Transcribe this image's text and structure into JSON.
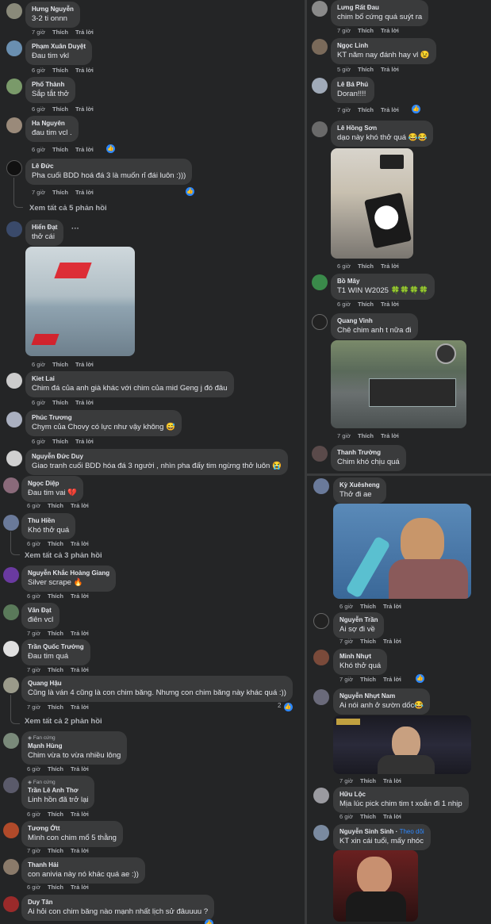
{
  "meta_labels": {
    "like": "Thích",
    "reply": "Trả lời"
  },
  "left_panel": {
    "comments": [
      {
        "name": "Hưng Nguyễn",
        "text": "3-2 ti onnn",
        "time": "7 giờ"
      },
      {
        "name": "Phạm Xuân Duyệt",
        "text": "Đau tim vkl",
        "time": "6 giờ"
      },
      {
        "name": "Phố Thành",
        "text": "Sắp tắt thở",
        "time": "6 giờ"
      },
      {
        "name": "Ha Nguyên",
        "text": "đau tim vcl .",
        "time": "6 giờ"
      },
      {
        "name": "Lê Đức",
        "text": "Pha cuối BDD hoá đá 3 là muốn rỉ đái luôn :)))",
        "time": "7 giờ"
      },
      {
        "name": "Hiển Đạt",
        "text": "thở cái",
        "time": "6 giờ"
      },
      {
        "name": "Kiet Lai",
        "text": "Chim đá của anh già khác với chim của mid Geng j đó đâu",
        "time": "6 giờ"
      },
      {
        "name": "Phúc Trương",
        "text": "Chym của Chovy có lực như vậy không 😅",
        "time": "6 giờ"
      },
      {
        "name": "Nguyễn Đức Duy",
        "text": "Giao tranh cuối BDD hóa đá 3 người , nhìn pha đấy tim ngừng thở luôn 😭",
        "time": ""
      },
      {
        "name": "Ngọc Diệp",
        "text": "Đau tim vai 💔",
        "time": "6 giờ"
      },
      {
        "name": "Thu Hiền",
        "text": "Khó thở quá",
        "time": "6 giờ"
      },
      {
        "name": "Nguyễn Khắc Hoàng Giang",
        "text": "Silver scrape 🔥",
        "time": "6 giờ"
      },
      {
        "name": "Văn Đạt",
        "text": "điên vcl",
        "time": "7 giờ"
      },
      {
        "name": "Trần Quốc Trưởng",
        "text": "Đau tim quá",
        "time": "7 giờ"
      },
      {
        "name": "Quang Hậu",
        "text": "Cũng là ván 4 cũng là con chim băng. Nhưng con chim băng này khác quá :))",
        "time": "7 giờ"
      },
      {
        "name": "Mạnh Hùng",
        "text": "Chim vừa to vừa nhiều lông",
        "time": "6 giờ",
        "badge": "Fan cứng"
      },
      {
        "name": "Trần Lê Anh Thơ",
        "text": "Linh hồn đã trở lại",
        "time": "6 giờ",
        "badge": "Fan cứng"
      },
      {
        "name": "Tương Ớtt",
        "text": "Mình con chim mổ 5 thằng",
        "time": "7 giờ"
      },
      {
        "name": "Thanh Hải",
        "text": "con anivia này nó khác quá ae :))",
        "time": "6 giờ"
      },
      {
        "name": "Duy Tân",
        "text": "Ai hỏi con chim băng nào mạnh nhất lịch sử đâuuuu ?",
        "time": ""
      }
    ],
    "more_replies": [
      "Xem tất cả 5 phản hồi",
      "Xem tất cả 3 phản hồi",
      "Xem tất cả 2 phản hồi"
    ],
    "reaction_count": "2"
  },
  "right_top_panel": {
    "comments": [
      {
        "name": "Lưng Rất Đau",
        "text": "chim bố cứng quá suýt ra",
        "time": "7 giờ"
      },
      {
        "name": "Ngọc Linh",
        "text": "KT năm nay đánh hay vl 😉",
        "time": "5 giờ"
      },
      {
        "name": "Lê Bá Phú",
        "text": "Doran!!!!",
        "time": "7 giờ"
      },
      {
        "name": "Lê Hồng Sơn",
        "text": "dạo này khó thở quá 😂😂",
        "time": "6 giờ"
      },
      {
        "name": "Bồ Mây",
        "text": "T1 WIN W2025 🍀🍀🍀🍀",
        "time": "6 giờ"
      },
      {
        "name": "Quang Vinh",
        "text": "Chê chim anh t nữa đi",
        "time": "7 giờ"
      },
      {
        "name": "Thanh Trường",
        "text": "Chim khó chịu quá",
        "time": ""
      }
    ]
  },
  "right_bottom_panel": {
    "comments": [
      {
        "name": "Kỳ Xuêsheng",
        "text": "Thở đi ae",
        "time": "6 giờ"
      },
      {
        "name": "Nguyễn Trần",
        "text": "Ai sợ đi về",
        "time": "7 giờ"
      },
      {
        "name": "Minh Nhựt",
        "text": "Khó thở quá",
        "time": "7 giờ"
      },
      {
        "name": "Nguyễn Nhựt Nam",
        "text": "Ai nói anh ở sườn dốc😂",
        "time": "7 giờ"
      },
      {
        "name": "Hữu Lộc",
        "text": "Mịa lúc pick chim tim t xoắn đi 1 nhịp",
        "time": "6 giờ"
      },
      {
        "name": "Nguyễn Sinh Sinh",
        "text": "KT xin cái tuổi, mấy nhóc",
        "time": "",
        "follow": "Theo dõi"
      }
    ]
  },
  "colors": {
    "panel_bg": "#242526",
    "bubble_bg": "#3a3b3c",
    "like_blue": "#2d88ff",
    "text": "#e4e6eb",
    "muted": "#b0b3b8"
  }
}
